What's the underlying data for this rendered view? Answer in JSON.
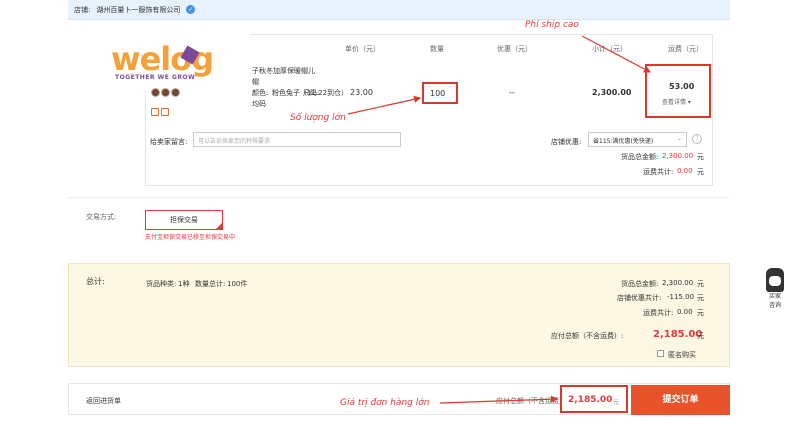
{
  "shop_bar": {
    "label": "店铺:",
    "shop_name": "湖州百量卜一服饰有限公司",
    "verified": "✓"
  },
  "columns": {
    "price": "单价（元）",
    "qty": "数量",
    "discount": "优惠（元）",
    "subtotal": "小计（元）",
    "shipping": "运费（元）"
  },
  "logo": {
    "text": "welog",
    "tagline": "TOGETHER WE GROW"
  },
  "product": {
    "name_line1": "子秋冬加厚保暖帽儿",
    "name_line2": "帽",
    "color_label": "颜色:",
    "color_value": "粉色兔子（11.22到仓）",
    "size_label": "尺码:",
    "size_value": "均码"
  },
  "row": {
    "price": "23.00",
    "qty": "100",
    "discount": "--",
    "subtotal": "2,300.00",
    "shipping": "53.00",
    "shipping_detail": "查看详情 ▾"
  },
  "note": {
    "label": "给卖家留言:",
    "placeholder": "可以告诉卖家您的特殊要求"
  },
  "shop_discount": {
    "label": "店铺优惠:",
    "value": "省115:满优惠(免快递)",
    "chevron": "⌄",
    "help": "?"
  },
  "card_summary": {
    "goods_total_label": "货品总金额:",
    "goods_total_value": "2,300.00",
    "goods_total_unit": "元",
    "shipping_total_label": "运费共计:",
    "shipping_total_value": "0.00",
    "shipping_total_unit": "元"
  },
  "payment": {
    "label": "交易方式:",
    "option": "担保交易",
    "note": "支付宝担保交易已移至担保交易中"
  },
  "summary": {
    "title": "总计:",
    "kinds_label": "货品种类:",
    "kinds_value": "1种",
    "qty_label": "数量总计:",
    "qty_value": "100件",
    "goods_label": "货品总金额:",
    "goods_value": "2,300.00",
    "goods_unit": "元",
    "discount_label": "店铺优惠共计:",
    "discount_value": "-115.00",
    "discount_unit": "元",
    "ship_label": "运费共计:",
    "ship_value": "0.00",
    "ship_unit": "元",
    "payable_label": "应付总额（不含运费）:",
    "payable_value": "2,185.00",
    "payable_unit": "元",
    "anonymous_label": "匿名购买"
  },
  "bottom": {
    "back_link": "返回进货单",
    "payable_label": "应付总额（不含运费）:",
    "total_value": "2,185.00",
    "total_unit": "元",
    "submit": "提交订单"
  },
  "annotations": {
    "shipping_high": "Phí ship cao",
    "qty_large": "Số lượng lớn",
    "order_value": "Giá trị đơn hàng lớn"
  },
  "side_widget": {
    "line1": "买家",
    "line2": "咨询"
  },
  "colors": {
    "accent": "#e8532b",
    "annotation": "#d63a2e",
    "price_red": "#e4393c",
    "summary_bg": "#fdf8e4",
    "shop_bar_bg": "#e8f2fd"
  }
}
